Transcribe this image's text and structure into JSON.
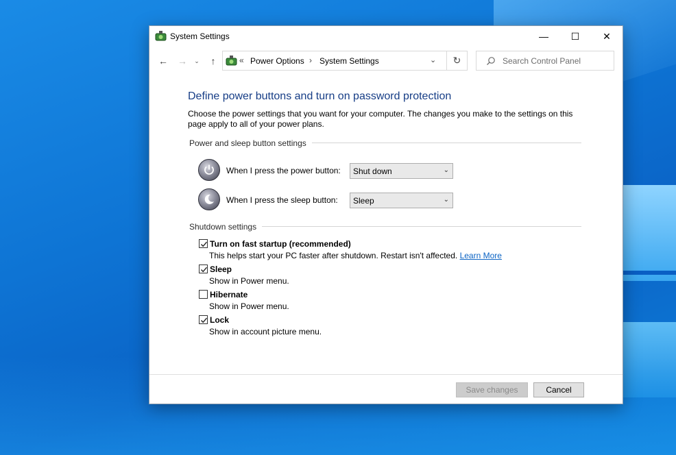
{
  "window": {
    "title": "System Settings",
    "controls": {
      "minimize": "—",
      "maximize": "☐",
      "close": "✕"
    }
  },
  "nav": {
    "back_icon": "←",
    "forward_icon": "→",
    "recent_icon": "⌄",
    "up_icon": "↑"
  },
  "address": {
    "overflow_chevron": "«",
    "breadcrumbs": [
      "Power Options",
      "System Settings"
    ],
    "separator": "›",
    "dropdown_icon": "⌄",
    "refresh_icon": "↻"
  },
  "search": {
    "placeholder": "Search Control Panel"
  },
  "content": {
    "heading": "Define power buttons and turn on password protection",
    "description": "Choose the power settings that you want for your computer. The changes you make to the settings on this page apply to all of your power plans.",
    "power_group": {
      "label": "Power and sleep button settings",
      "rows": [
        {
          "label": "When I press the power button:",
          "value": "Shut down",
          "icon": "power-icon"
        },
        {
          "label": "When I press the sleep button:",
          "value": "Sleep",
          "icon": "sleep-icon"
        }
      ]
    },
    "shutdown_group": {
      "label": "Shutdown settings",
      "items": [
        {
          "title": "Turn on fast startup (recommended)",
          "desc": "This helps start your PC faster after shutdown. Restart isn't affected.",
          "link": "Learn More",
          "checked": true
        },
        {
          "title": "Sleep",
          "desc": "Show in Power menu.",
          "checked": true
        },
        {
          "title": "Hibernate",
          "desc": "Show in Power menu.",
          "checked": false
        },
        {
          "title": "Lock",
          "desc": "Show in account picture menu.",
          "checked": true
        }
      ]
    }
  },
  "footer": {
    "save_label": "Save changes",
    "cancel_label": "Cancel"
  },
  "colors": {
    "heading": "#163d86",
    "link": "#0b63c4",
    "desktop": "#0e74d4"
  }
}
